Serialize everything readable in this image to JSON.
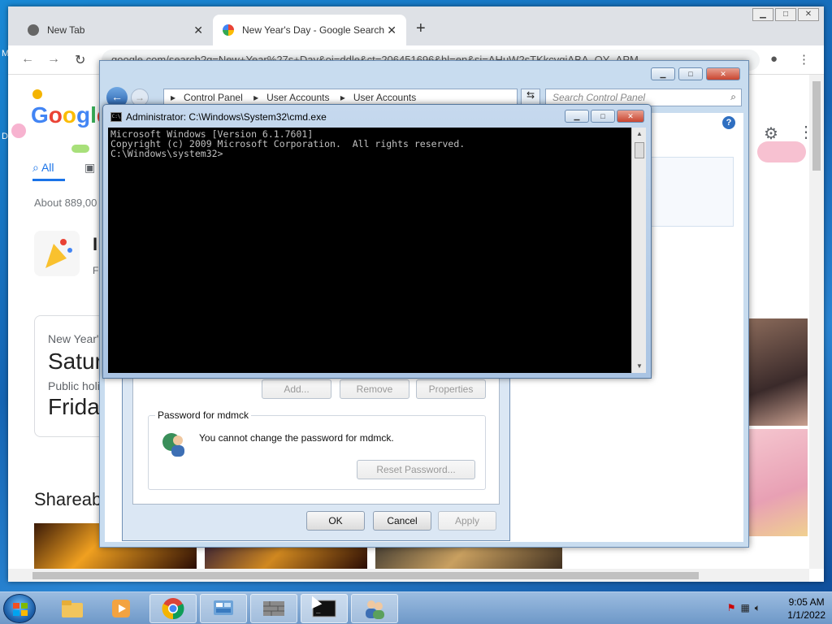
{
  "browser": {
    "tabs": [
      {
        "title": "New Tab"
      },
      {
        "title": "New Year's Day - Google Search"
      }
    ],
    "url": "google.com/search?q=New+Year%27s+Day&oi=ddle&ct=206451696&hl=en&si=AHuW2sTKkcvgiABA_OY_APM",
    "google": {
      "tab_all": "All",
      "about": "About 889,00",
      "card": {
        "kicker1": "New Year'",
        "day1": "Satur",
        "kicker2": "Public holi",
        "day2": "Frida"
      },
      "shareable": "Shareab"
    }
  },
  "control_panel": {
    "breadcrumb": [
      "Control Panel",
      "User Accounts",
      "User Accounts"
    ],
    "search_placeholder": "Search Control Panel"
  },
  "user_accounts_dialog": {
    "buttons": {
      "add": "Add...",
      "remove": "Remove",
      "properties": "Properties",
      "reset_password": "Reset Password...",
      "ok": "OK",
      "cancel": "Cancel",
      "apply": "Apply"
    },
    "password_group": {
      "title": "Password for mdmck",
      "message": "You cannot change the password for mdmck."
    }
  },
  "cmd": {
    "title": "Administrator: C:\\Windows\\System32\\cmd.exe",
    "lines": [
      "Microsoft Windows [Version 6.1.7601]",
      "Copyright (c) 2009 Microsoft Corporation.  All rights reserved.",
      "",
      "C:\\Windows\\system32>"
    ]
  },
  "taskbar": {
    "time": "9:05 AM",
    "date": "1/1/2022"
  }
}
